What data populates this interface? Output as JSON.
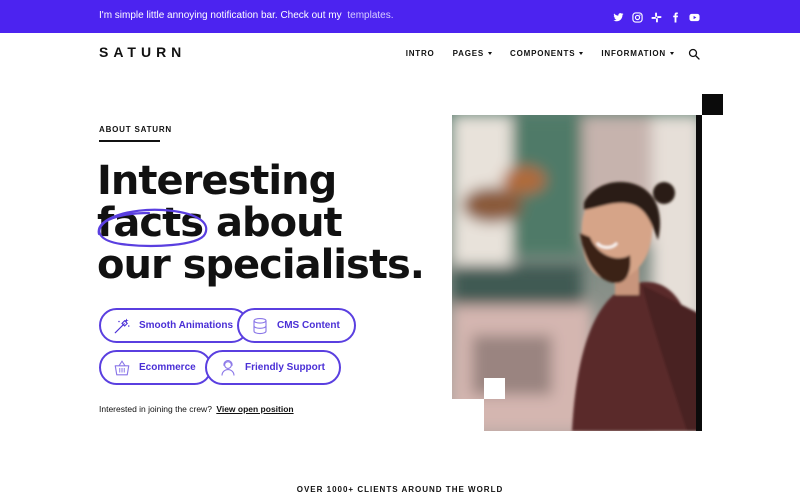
{
  "notification": {
    "text": "I'm simple little annoying notification bar. Check out my",
    "link_text": "templates."
  },
  "social_icons": [
    "twitter-icon",
    "instagram-icon",
    "slack-icon",
    "facebook-icon",
    "youtube-icon"
  ],
  "brand": {
    "logo": "SATURN"
  },
  "nav": {
    "items": [
      {
        "label": "INTRO",
        "has_caret": false
      },
      {
        "label": "PAGES",
        "has_caret": true
      },
      {
        "label": "COMPONENTS",
        "has_caret": true
      },
      {
        "label": "INFORMATION",
        "has_caret": true
      }
    ],
    "search_icon": "search-icon"
  },
  "hero": {
    "eyebrow": "ABOUT SATURN",
    "headline_line1": "Interesting",
    "headline_highlight": "facts",
    "headline_line2_rest": " about",
    "headline_line3": "our specialists.",
    "features": [
      {
        "label": "Smooth Animations",
        "icon": "magic-wand-icon"
      },
      {
        "label": "CMS Content",
        "icon": "database-icon"
      },
      {
        "label": "Ecommerce",
        "icon": "shopping-basket-icon"
      },
      {
        "label": "Friendly Support",
        "icon": "support-agent-icon"
      }
    ],
    "join_text": "Interested in joining the crew?",
    "join_link": "View open position"
  },
  "clients_caption": "OVER 1000+ CLIENTS AROUND THE WORLD",
  "colors": {
    "accent": "#4c23f0",
    "button_border": "#5a3fe0",
    "button_text": "#4a2fd6",
    "text": "#111111"
  }
}
